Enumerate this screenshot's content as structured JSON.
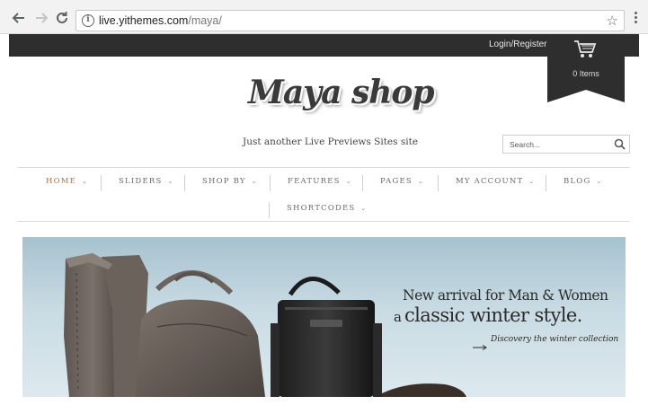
{
  "browser": {
    "url_host": "live.yithemes.com",
    "url_path": "/maya/",
    "icons": [
      "back-arrow-icon",
      "forward-arrow-icon",
      "reload-icon",
      "info-icon",
      "star-icon",
      "menu-dots-icon"
    ]
  },
  "topbar": {
    "login_label": "Login/Register",
    "cart_count": "0 Items"
  },
  "header": {
    "logo": "Maya shop",
    "tagline": "Just another Live Previews Sites site",
    "search_placeholder": "Search..."
  },
  "menu": {
    "items": [
      {
        "label": "HOME",
        "active": true
      },
      {
        "label": "SLIDERS"
      },
      {
        "label": "SHOP BY"
      },
      {
        "label": "FEATURES"
      },
      {
        "label": "PAGES"
      },
      {
        "label": "MY ACCOUNT"
      },
      {
        "label": "BLOG"
      },
      {
        "label": "SHORTCODES"
      }
    ]
  },
  "hero": {
    "line1": "New arrival for Man & Women",
    "line2_prefix": "a",
    "line2_main": "classic winter style.",
    "cta": "Discovery the winter collection"
  },
  "colors": {
    "topbar": "#2e2e2e",
    "active_menu": "#b0724a",
    "text_dark": "#2b2b2b"
  }
}
